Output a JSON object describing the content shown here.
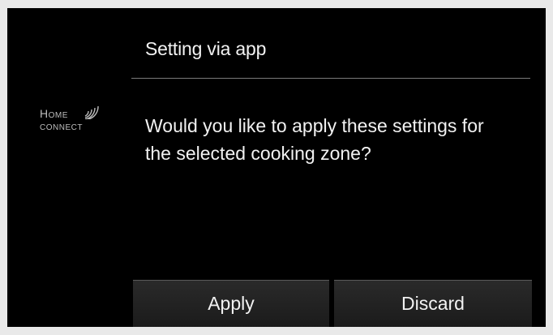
{
  "dialog": {
    "title": "Setting via app",
    "message": "Would you like to apply these settings for the selected cooking zone?"
  },
  "logo": {
    "line1": "Home",
    "line2": "connect",
    "icon": "wifi-signal-icon"
  },
  "buttons": {
    "apply_label": "Apply",
    "discard_label": "Discard"
  },
  "colors": {
    "background": "#000000",
    "text": "#f2f2f2",
    "button_bg": "#232323",
    "divider": "#7a7a7a"
  }
}
